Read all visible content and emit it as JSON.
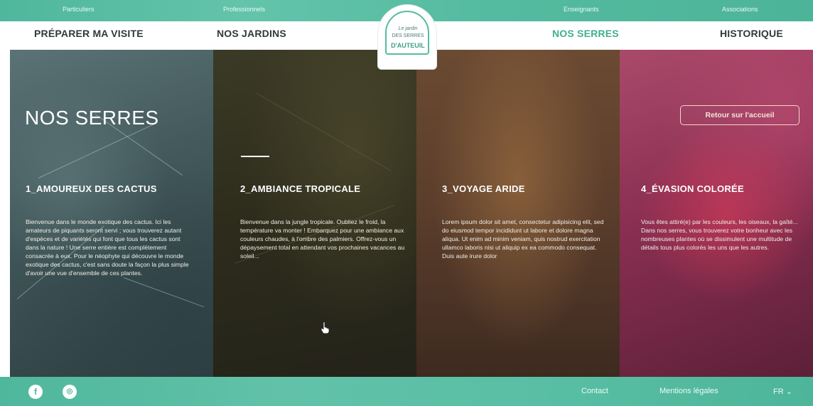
{
  "topbar": {
    "audiences": [
      "Particuliers",
      "Professionnels",
      "Enseignants",
      "Associations"
    ]
  },
  "nav": {
    "items": [
      "PRÉPARER MA VISITE",
      "NOS JARDINS",
      "NOS SERRES",
      "HISTORIQUE"
    ],
    "active": "NOS SERRES"
  },
  "logo": {
    "line1": "Le jardin",
    "line2": "DES SERRES",
    "line3": "D'AUTEUIL"
  },
  "page": {
    "title": "NOS SERRES",
    "back_button": "Retour sur l'accueil"
  },
  "panels": [
    {
      "title": "1_AMOUREUX DES CACTUS",
      "description": "Bienvenue dans le monde exotique des cactus. Ici les amateurs de piquants seront servi ; vous trouverez autant d'espèces et de variétés qui font que tous les cactus sont dans la nature ! Une serre entière est complètement consacrée à eux. Pour le néophyte qui découvre le monde exotique des cactus, c'est sans doute la façon la plus simple d'avoir une vue d'ensemble de ces plantes."
    },
    {
      "title": "2_AMBIANCE TROPICALE",
      "description": "Bienvenue dans la jungle tropicale. Oubliez le froid, la température va monter ! Embarquez pour une ambiance aux couleurs chaudes, à l'ombre des palmiers. Offrez-vous un dépaysement total en attendant vos prochaines vacances au soleil..."
    },
    {
      "title": "3_VOYAGE ARIDE",
      "description": "Lorem ipsum dolor sit amet, consectetur adipisicing elit, sed do eiusmod tempor incididunt ut labore et dolore magna aliqua. Ut enim ad minim veniam, quis nostrud exercitation ullamco laboris nisi ut aliquip ex ea commodo consequat. Duis aute irure dolor"
    },
    {
      "title": "4_ÉVASION COLORÉE",
      "description": "Vous êtes attiré(e) par les couleurs, les oiseaux, la gaîté... Dans nos serres, vous trouverez votre bonheur avec les nombreuses plantes où se dissimulent une multitude de détails tous plus colorés les uns que les autres."
    }
  ],
  "footer": {
    "social": [
      "facebook-icon",
      "instagram-icon"
    ],
    "contact": "Contact",
    "legal": "Mentions légales",
    "lang": "FR"
  },
  "colors": {
    "accent": "#55bba0",
    "nav_active": "#3fb08f",
    "nav_text": "#2f3a3a"
  }
}
